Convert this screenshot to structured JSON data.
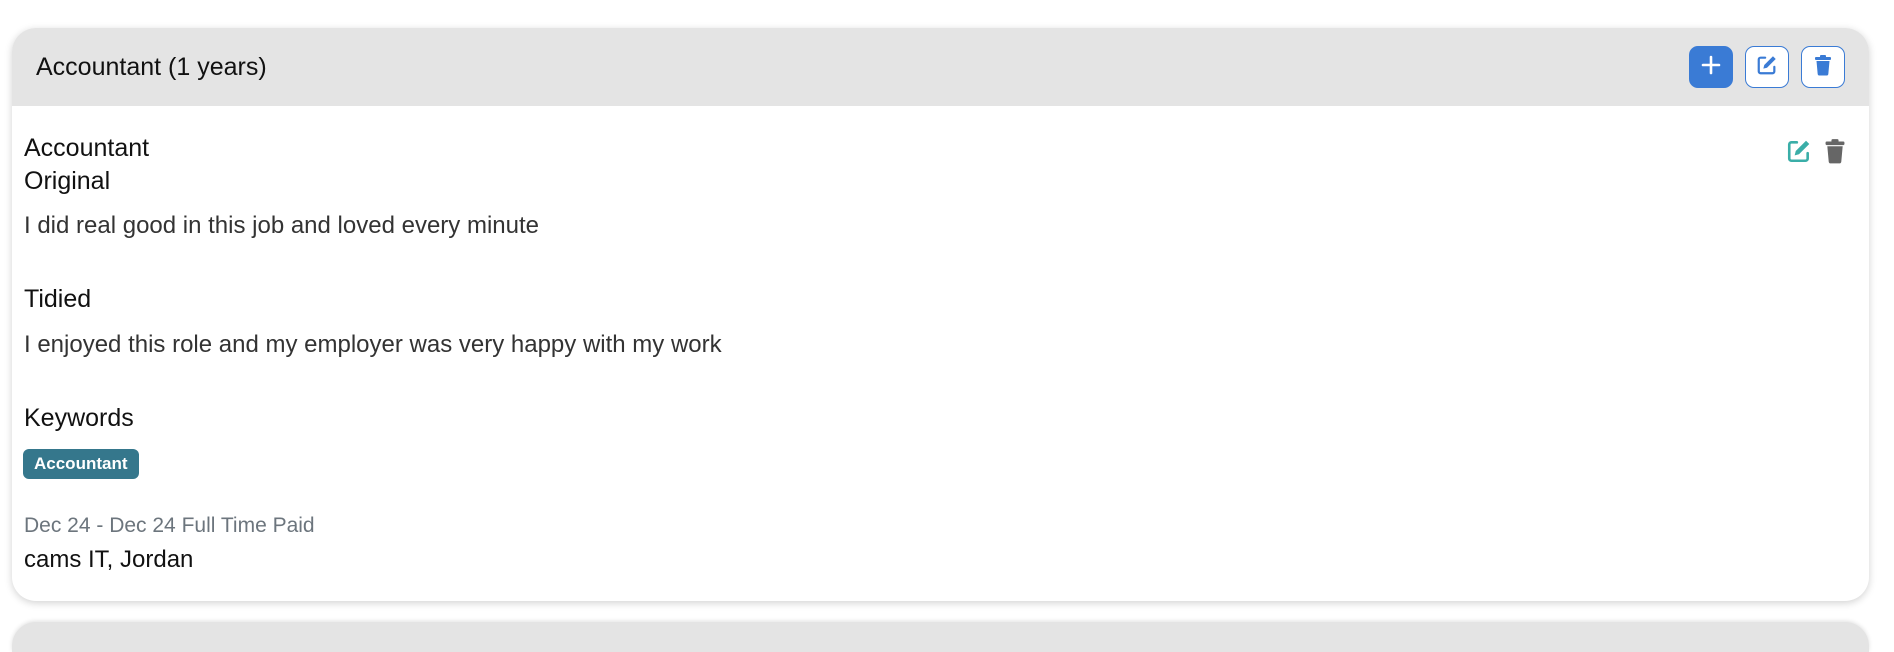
{
  "header": {
    "title": "Accountant (1 years)",
    "accent_color": "#3a7bd5"
  },
  "entry": {
    "role": "Accountant",
    "original_label": "Original",
    "original_text": "I did real good in this job and loved every minute",
    "tidied_label": "Tidied",
    "tidied_text": "I enjoyed this role and my employer was very happy with my work",
    "keywords_label": "Keywords",
    "keywords": [
      "Accountant"
    ],
    "dates": "Dec 24 - Dec 24 Full Time Paid",
    "employer": "cams IT, Jordan"
  },
  "icons": {
    "add": "plus-icon",
    "edit": "edit-icon",
    "delete": "trash-icon"
  },
  "colors": {
    "header_bg": "#e4e4e4",
    "badge_bg": "#35778c",
    "edit_teal": "#3aaea8",
    "trash_gray": "#666666"
  }
}
